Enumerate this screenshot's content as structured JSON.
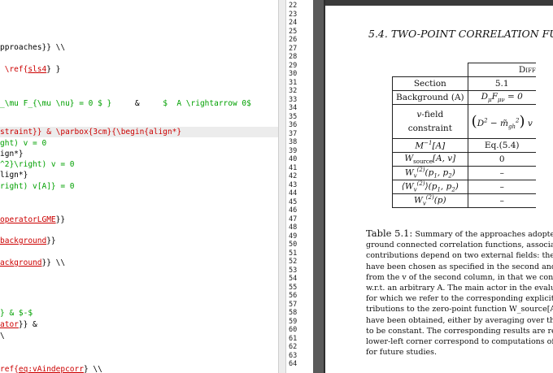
{
  "editor": {
    "lines": [
      {
        "parts": [
          {
            "t": "pproaches}} \\\\",
            "c": ""
          }
        ]
      },
      {
        "parts": [
          {
            "t": " \\ref{",
            "c": "rd"
          },
          {
            "t": "sls4",
            "c": "ul"
          },
          {
            "t": "} }",
            "c": ""
          }
        ]
      },
      {
        "parts": [
          {
            "t": "_\\mu F_{\\mu \\nu} = 0 $ }",
            "c": "gr"
          },
          {
            "t": "     &     ",
            "c": ""
          },
          {
            "t": "$  A \\rightarrow 0$",
            "c": "gr"
          }
        ]
      },
      {
        "parts": [
          {
            "t": "straint}} & \\parbox{3cm}{\\begin{align*}",
            "c": "rd"
          }
        ]
      },
      {
        "parts": [
          {
            "t": "ght) v = 0",
            "c": "gr"
          }
        ]
      },
      {
        "parts": [
          {
            "t": "ign*}",
            "c": ""
          }
        ]
      },
      {
        "parts": [
          {
            "t": "^2}\\right) v = 0",
            "c": "gr"
          }
        ]
      },
      {
        "parts": [
          {
            "t": "lign*}",
            "c": ""
          }
        ]
      },
      {
        "parts": [
          {
            "t": "right) v[A]} = 0",
            "c": "gr"
          }
        ]
      },
      {
        "parts": [
          {
            "t": "operatorLGME",
            "c": "ul"
          },
          {
            "t": "}}",
            "c": ""
          }
        ]
      },
      {
        "parts": [
          {
            "t": "background",
            "c": "ul"
          },
          {
            "t": "}}",
            "c": ""
          }
        ]
      },
      {
        "parts": [
          {
            "t": "ackground",
            "c": "ul"
          },
          {
            "t": "}} \\\\",
            "c": ""
          }
        ]
      },
      {
        "parts": [
          {
            "t": "} & $-$",
            "c": "gr"
          }
        ]
      },
      {
        "parts": [
          {
            "t": "ator",
            "c": "ul"
          },
          {
            "t": "}} &",
            "c": ""
          }
        ]
      },
      {
        "parts": [
          {
            "t": "\\",
            "c": ""
          }
        ]
      },
      {
        "parts": [
          {
            "t": "ref{",
            "c": "rd"
          },
          {
            "t": "eq:vAindepcorr",
            "c": "ul"
          },
          {
            "t": "} \\\\",
            "c": ""
          }
        ]
      }
    ]
  },
  "line_numbers": [
    "22",
    "23",
    "24",
    "25",
    "26",
    "27",
    "28",
    "29",
    "30",
    "31",
    "32",
    "33",
    "34",
    "35",
    "36",
    "37",
    "38",
    "39",
    "40",
    "41",
    "42",
    "43",
    "44",
    "45",
    "46",
    "47",
    "48",
    "49",
    "50",
    "51",
    "52",
    "53",
    "54",
    "55",
    "56",
    "57",
    "58",
    "59",
    "60",
    "61",
    "62",
    "63",
    "64"
  ],
  "pdf": {
    "running_head": "5.4.  TWO-POINT CORRELATION FUNC",
    "table": {
      "header_partial": "Diff",
      "rows": [
        {
          "label": "Section",
          "value": "5.1"
        },
        {
          "label": "Background (A)",
          "value": "D_μF_μν = 0"
        },
        {
          "label_line1": "v-field",
          "label_line2": "constraint",
          "value": "(D² − m̃²_gh) v"
        },
        {
          "label": "M⁻¹[A]",
          "value": "Eq.(5.4)"
        },
        {
          "label": "W_source[A, v]",
          "value": "0"
        },
        {
          "label": "W_v^(2)(p₁, p₂)",
          "value": "–"
        },
        {
          "label": "⟨W_v^(2)⟩(p₁, p₂)",
          "value": "–"
        },
        {
          "label": "W_v^(2)(p)",
          "value": "–"
        }
      ]
    },
    "caption": {
      "label": "Table 5.1:",
      "first_line_rest": "Summary of the approaches adopted",
      "lines": [
        "ground connected correlation functions, associat",
        "contributions depend on two external fields: the",
        "have been chosen as specified in the second and th",
        "from the v of the second column, in that we consi",
        "w.r.t. an arbitrary A. The main actor in the evalu",
        "for which we refer to the corresponding explicit",
        "tributions to the zero-point function W_source[A] ar",
        "have been obtained, either by averaging over the",
        "to be constant. The corresponding results are re",
        "lower-left corner correspond to computations of",
        "for future studies."
      ]
    }
  }
}
